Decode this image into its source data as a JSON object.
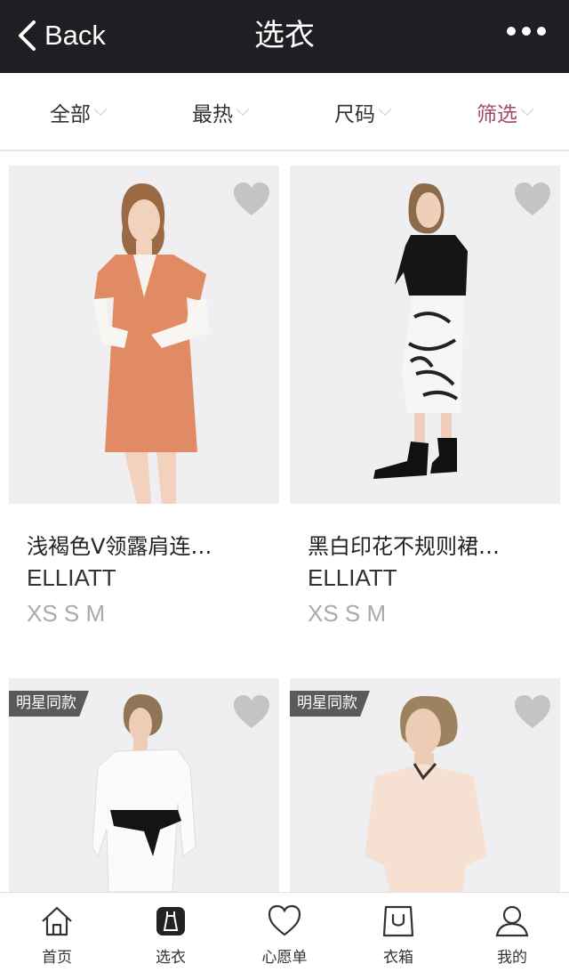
{
  "navbar": {
    "back_label": "Back",
    "title": "选衣"
  },
  "filters": [
    {
      "label": "全部"
    },
    {
      "label": "最热"
    },
    {
      "label": "尺码"
    },
    {
      "label": "筛选"
    }
  ],
  "products": [
    {
      "name": "浅褐色V领露肩连…",
      "brand": "ELLIATT",
      "sizes": "XS S M",
      "badge": ""
    },
    {
      "name": "黑白印花不规则裙…",
      "brand": "ELLIATT",
      "sizes": "XS S M",
      "badge": ""
    },
    {
      "name": "",
      "brand": "",
      "sizes": "",
      "badge": "明星同款"
    },
    {
      "name": "",
      "brand": "",
      "sizes": "",
      "badge": "明星同款"
    }
  ],
  "tabs": [
    {
      "label": "首页",
      "icon": "home-icon"
    },
    {
      "label": "选衣",
      "icon": "dress-icon"
    },
    {
      "label": "心愿单",
      "icon": "heart-icon"
    },
    {
      "label": "衣箱",
      "icon": "bag-icon"
    },
    {
      "label": "我的",
      "icon": "user-icon"
    }
  ],
  "colors": {
    "navbar": "#1f1e22",
    "accent": "#a4496e",
    "photo_bg": "#efeef0"
  }
}
